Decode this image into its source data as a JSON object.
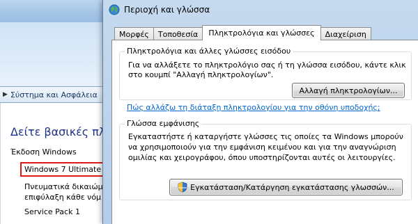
{
  "background_window": {
    "breadcrumb": "Σύστημα και Ασφάλεια",
    "heading": "Δείτε βασικές πληρ",
    "edition_label": "Έκδοση Windows",
    "edition_value": "Windows 7 Ultimate",
    "rights_line1": "Πνευματικά δικαιώμ",
    "rights_line2": "επιφύλαξη κάθε νόμ",
    "service_pack": "Service Pack 1"
  },
  "dialog": {
    "title": "Περιοχή και γλώσσα",
    "icon": "globe-icon",
    "tabs": [
      {
        "label": "Μορφές",
        "active": false
      },
      {
        "label": "Τοποθεσία",
        "active": false
      },
      {
        "label": "Πληκτρολόγια και γλώσσες",
        "active": true
      },
      {
        "label": "Διαχείριση",
        "active": false
      }
    ],
    "keyboards_group": {
      "legend": "Πληκτρολόγια και άλλες γλώσσες εισόδου",
      "description": "Για να αλλάξετε το πληκτρολόγιο σας ή τη γλώσσα εισόδου, κάντε κλικ στο κουμπί \"Αλλαγή πληκτρολογίων\".",
      "button_label": "Αλλαγή πληκτρολογίων...",
      "link": "Πώς αλλάζω τη διάταξη πληκτρολογίου για την οθόνη υποδοχής;"
    },
    "display_language_group": {
      "legend": "Γλώσσα εμφάνισης",
      "description": "Εγκαταστήστε ή καταργήστε γλώσσες τις οποίες τα Windows μπορούν να χρησιμοποιούν για την εμφάνιση κειμένου και για την αναγνώριση ομιλίας και χειρογράφου, όπου υποστηρίζονται αυτές οι λειτουργίες.",
      "button_label": "Εγκατάσταση/Κατάργηση εγκατάστασης γλωσσών...",
      "button_icon": "uac-shield-icon"
    }
  },
  "colors": {
    "link": "#0066cc",
    "heading": "#1e3287",
    "highlight_border": "#e01818"
  }
}
